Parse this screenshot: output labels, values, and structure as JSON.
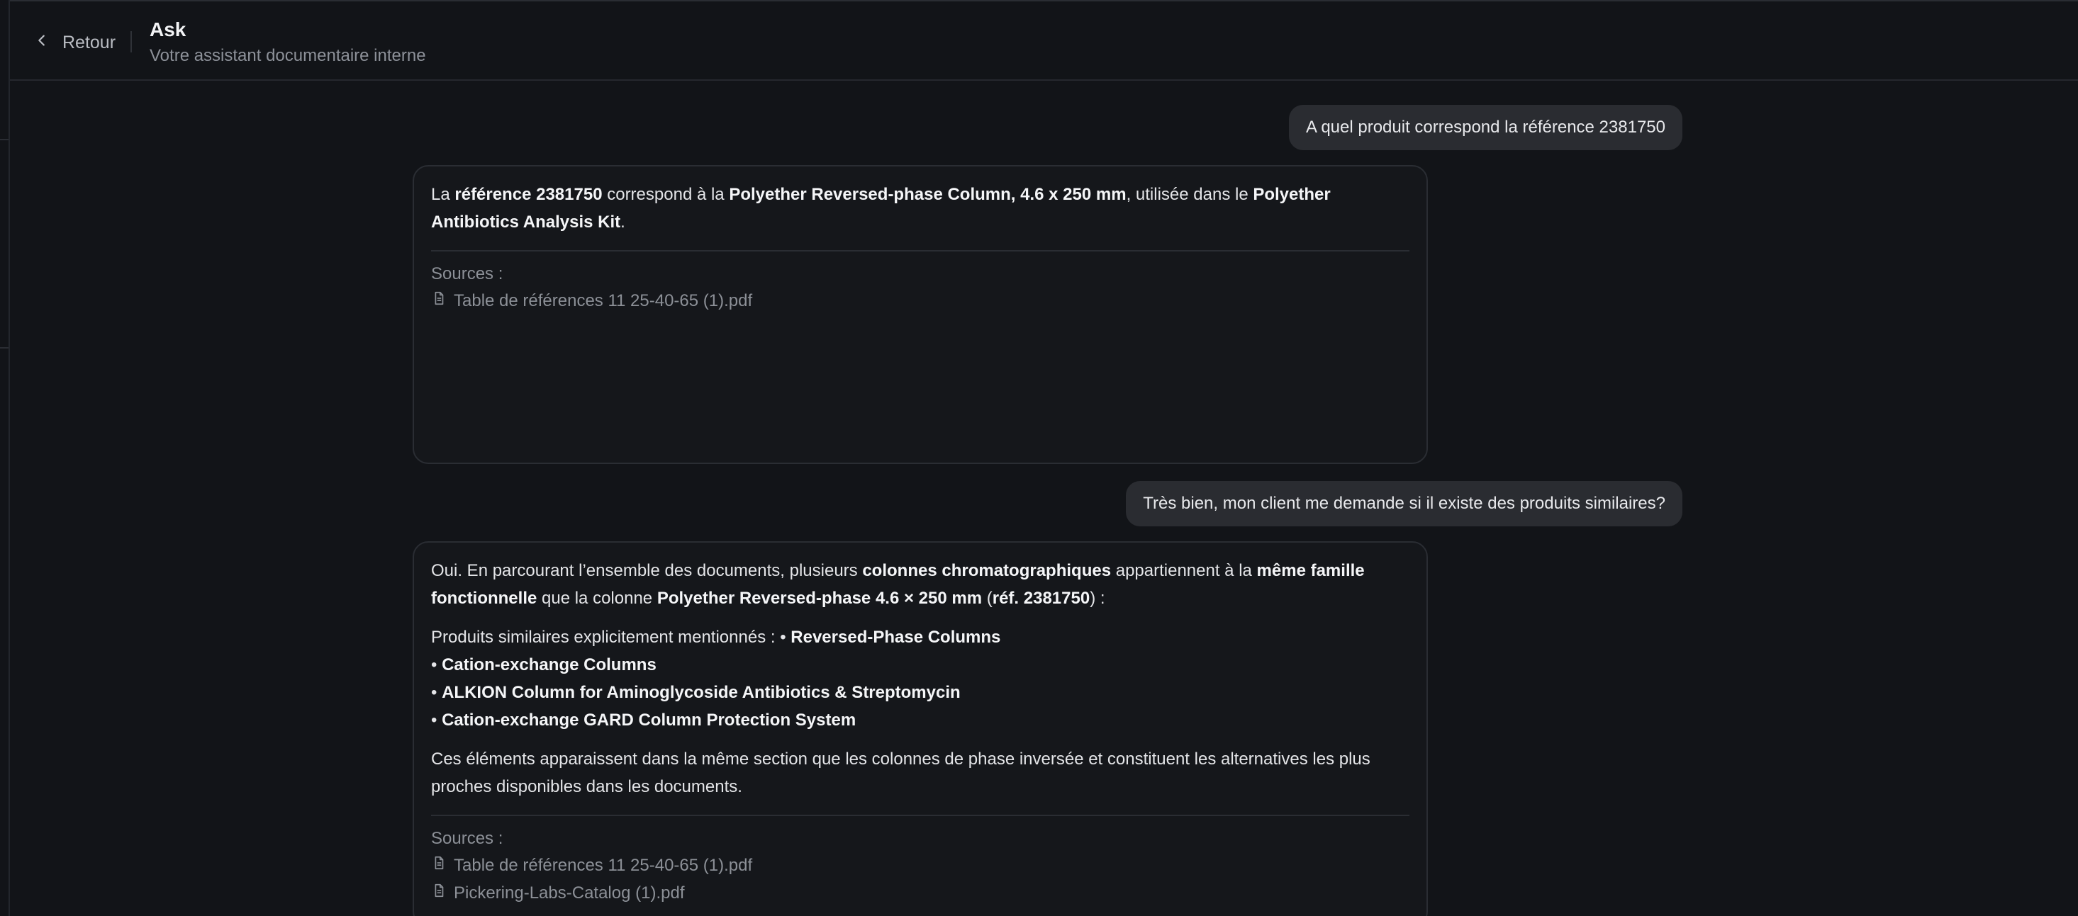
{
  "header": {
    "back_label": "Retour",
    "title": "Ask",
    "subtitle": "Votre assistant documentaire interne"
  },
  "conversation": {
    "q1": "A quel produit correspond la référence 2381750",
    "a1": {
      "p1": [
        {
          "t": "La ",
          "b": false
        },
        {
          "t": "référence 2381750",
          "b": true
        },
        {
          "t": " correspond à la ",
          "b": false
        },
        {
          "t": "Polyether Reversed-phase Column, 4.6 x 250 mm",
          "b": true
        },
        {
          "t": ", utilisée dans le ",
          "b": false
        },
        {
          "t": "Polyether Antibiotics Analysis Kit",
          "b": true
        },
        {
          "t": ".",
          "b": false
        }
      ],
      "sources_label": "Sources :",
      "sources": [
        "Table de références 11 25-40-65 (1).pdf"
      ]
    },
    "q2": "Très bien, mon client me demande si il existe des produits similaires?",
    "a2": {
      "p1": [
        {
          "t": "Oui. En parcourant l’ensemble des documents, plusieurs ",
          "b": false
        },
        {
          "t": "colonnes chromatographiques",
          "b": true
        },
        {
          "t": " appartiennent à la ",
          "b": false
        },
        {
          "t": "même famille fonctionnelle",
          "b": true
        },
        {
          "t": " que la colonne ",
          "b": false
        },
        {
          "t": "Polyether Reversed-phase 4.6 × 250 mm",
          "b": true
        },
        {
          "t": " (",
          "b": false
        },
        {
          "t": "réf. 2381750",
          "b": true
        },
        {
          "t": ") :",
          "b": false
        }
      ],
      "list_intro": "Produits similaires explicitement mentionnés : • ",
      "list_first": "Reversed-Phase Columns",
      "list_items": [
        "Cation-exchange Columns",
        "ALKION Column for Aminoglycoside Antibiotics & Streptomycin",
        "Cation-exchange GARD Column Protection System"
      ],
      "bullet": "• ",
      "p3": "Ces éléments apparaissent dans la même section que les colonnes de phase inversée et constituent les alternatives les plus proches disponibles dans les documents.",
      "sources_label": "Sources :",
      "sources": [
        "Table de références 11 25-40-65 (1).pdf",
        "Pickering-Labs-Catalog (1).pdf"
      ]
    }
  },
  "icons": {
    "back": "chevron-left-icon",
    "source": "file-icon"
  }
}
